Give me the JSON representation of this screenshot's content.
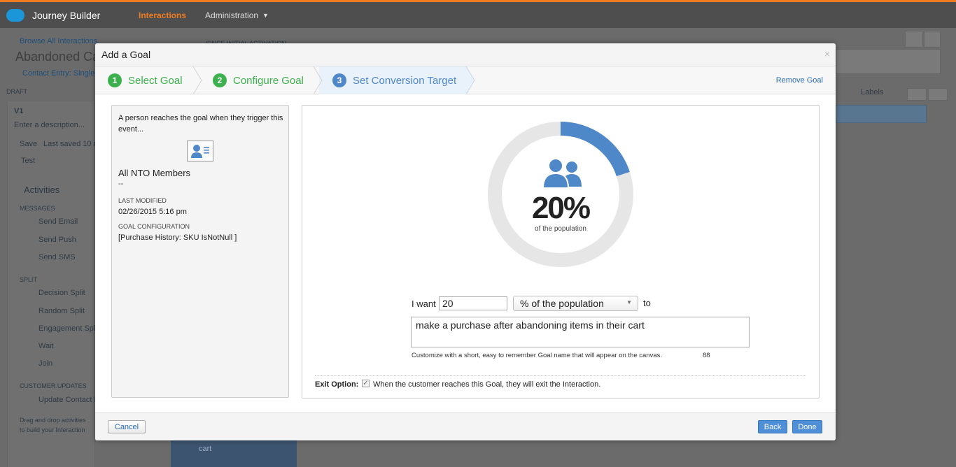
{
  "topbar": {
    "app_title": "Journey Builder",
    "nav_interactions": "Interactions",
    "nav_administration": "Administration"
  },
  "background": {
    "browse_link": "Browse All Interactions",
    "since_label": "SINCE INITIAL ACTIVATION",
    "title": "Abandoned Ca",
    "contact_entry": "Contact Entry: Single E",
    "draft": "DRAFT",
    "version": "V1",
    "description_placeholder": "Enter a description...",
    "save": "Save",
    "last_saved": "Last saved 10 m",
    "test": "Test",
    "activities": "Activities",
    "messages": "MESSAGES",
    "send_email": "Send Email",
    "send_push": "Send Push",
    "send_sms": "Send SMS",
    "split": "SPLIT",
    "decision_split": "Decision Split",
    "random_split": "Random Split",
    "engagement_split": "Engagement Spl",
    "wait": "Wait",
    "join": "Join",
    "customer_updates": "CUSTOMER UPDATES",
    "update_contact": "Update Contact D",
    "drag_hint_1": "Drag and drop activities",
    "drag_hint_2": "to build your Interaction",
    "labels": "Labels",
    "canvas_text": "cart"
  },
  "modal": {
    "title": "Add a Goal",
    "close": "×",
    "remove_goal": "Remove Goal",
    "steps": [
      {
        "num": "1",
        "label": "Select Goal"
      },
      {
        "num": "2",
        "label": "Configure Goal"
      },
      {
        "num": "3",
        "label": "Set Conversion Target"
      }
    ]
  },
  "goal_card": {
    "description": "A person reaches the goal when they trigger this event...",
    "name": "All NTO Members",
    "dash": "--",
    "last_modified_label": "LAST MODIFIED",
    "last_modified": "02/26/2015 5:16 pm",
    "config_label": "GOAL CONFIGURATION",
    "config": "[Purchase History: SKU IsNotNull ]"
  },
  "target": {
    "percent": 20,
    "percent_text": "20%",
    "subtitle": "of the population",
    "i_want": "I want",
    "value": "20",
    "unit_option": "% of the population",
    "to": "to",
    "goal_name": "make a purchase after abandoning items in their cart",
    "hint": "Customize with a short, easy to remember Goal name that will appear on the canvas.",
    "char_count": "88",
    "exit_label": "Exit Option:",
    "exit_text": "When the customer reaches this Goal, they will exit the Interaction.",
    "exit_checked": true
  },
  "footer": {
    "cancel": "Cancel",
    "back": "Back",
    "done": "Done"
  },
  "colors": {
    "accent": "#f07c22",
    "blue": "#4f88c8",
    "green": "#3bb04c"
  }
}
